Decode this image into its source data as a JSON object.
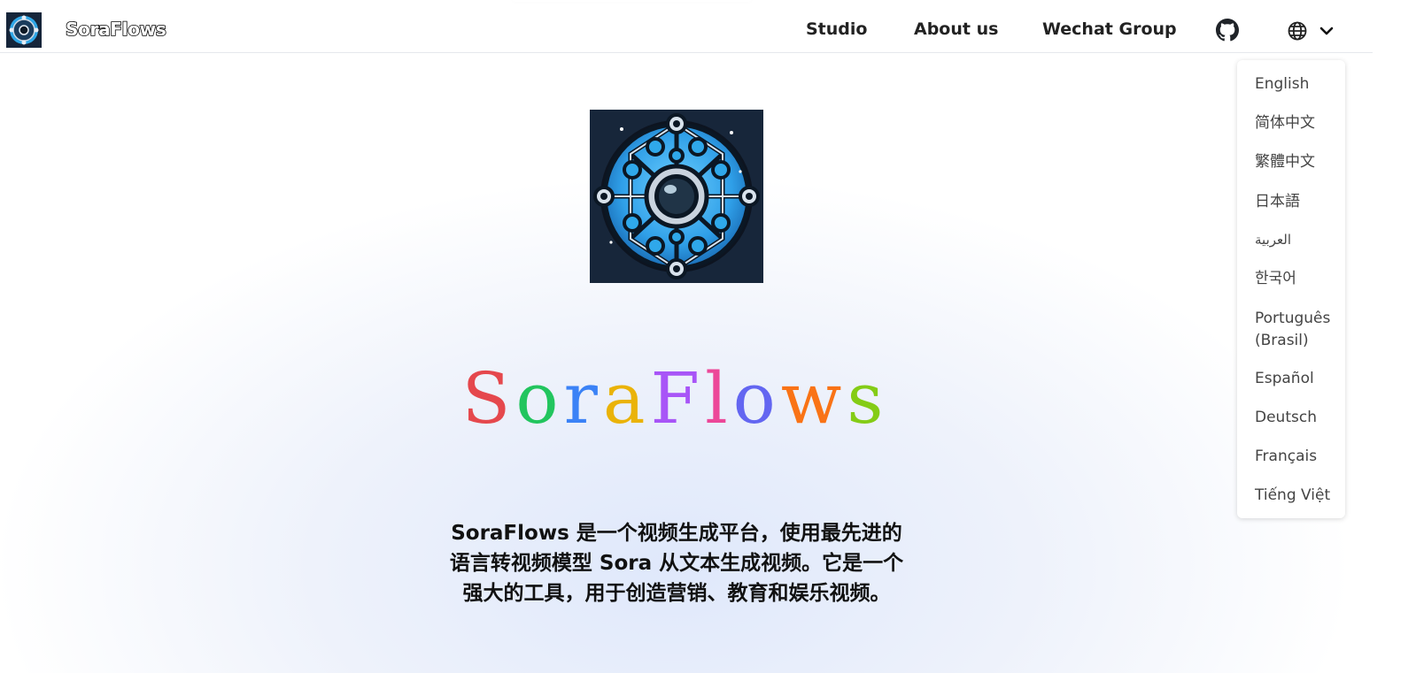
{
  "header": {
    "brand": "SoraFlows",
    "nav": [
      {
        "label": "Studio"
      },
      {
        "label": "About us"
      },
      {
        "label": "Wechat Group"
      }
    ],
    "icons": {
      "github": "github-icon",
      "language": "globe-icon",
      "chevron": "chevron-down-icon"
    }
  },
  "language_menu": [
    "English",
    "简体中文",
    "繁體中文",
    "日本語",
    "العربية",
    "한국어",
    "Português (Brasil)",
    "Español",
    "Deutsch",
    "Français",
    "Tiếng Việt"
  ],
  "hero": {
    "title_letters": [
      {
        "char": "S",
        "color": "#e5484d"
      },
      {
        "char": "o",
        "color": "#22c55e"
      },
      {
        "char": "r",
        "color": "#3b82f6"
      },
      {
        "char": "a",
        "color": "#eab308"
      },
      {
        "char": "F",
        "color": "#a855f7"
      },
      {
        "char": "l",
        "color": "#ec4899"
      },
      {
        "char": "o",
        "color": "#6366f1"
      },
      {
        "char": "w",
        "color": "#f97316"
      },
      {
        "char": "s",
        "color": "#84cc16"
      }
    ],
    "description": "SoraFlows 是一个视频生成平台，使用最先进的语言转视频模型 Sora 从文本生成视频。它是一个强大的工具，用于创造营销、教育和娱乐视频。"
  }
}
